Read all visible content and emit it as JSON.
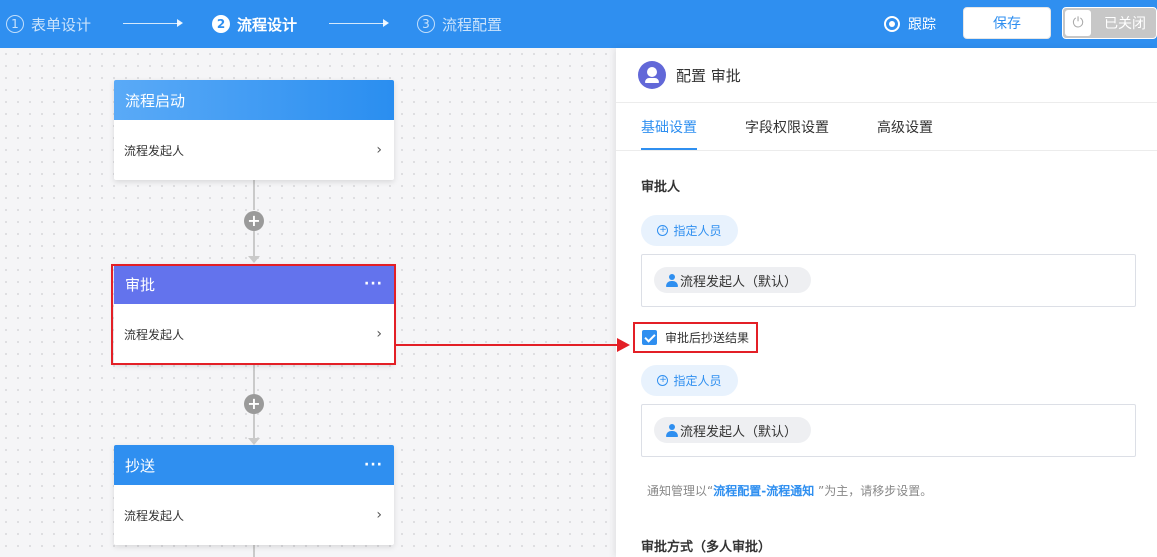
{
  "topbar": {
    "steps": [
      {
        "num": "1",
        "label": "表单设计"
      },
      {
        "num": "2",
        "label": "流程设计"
      },
      {
        "num": "3",
        "label": "流程配置"
      }
    ],
    "track_label": "跟踪",
    "save_label": "保存",
    "toggle_label": "已关闭",
    "toggle_icon": "⏻"
  },
  "canvas": {
    "nodes": [
      {
        "title": "流程启动",
        "body": "流程发起人",
        "chevron": "›"
      },
      {
        "title": "审批",
        "body": "流程发起人",
        "chevron": "›",
        "more": "···"
      },
      {
        "title": "抄送",
        "body": "流程发起人",
        "chevron": "›",
        "more": "···"
      }
    ],
    "plus_symbol": "+"
  },
  "panel": {
    "title": "配置 审批",
    "tabs": [
      "基础设置",
      "字段权限设置",
      "高级设置"
    ],
    "approver_title": "审批人",
    "assign_label": "指定人员",
    "assign_icon": "+",
    "default_tag": "流程发起人（默认）",
    "cc_checkbox_label": "审批后抄送结果",
    "notice": {
      "prefix": "通知管理以“",
      "link": "流程配置-流程通知",
      "suffix": " ”为主，请移步设置。"
    },
    "method_title": "审批方式（多人审批）"
  },
  "colors": {
    "primary": "#2f8ff0",
    "approve_header": "#6373ed",
    "annotation": "#e31f26"
  }
}
